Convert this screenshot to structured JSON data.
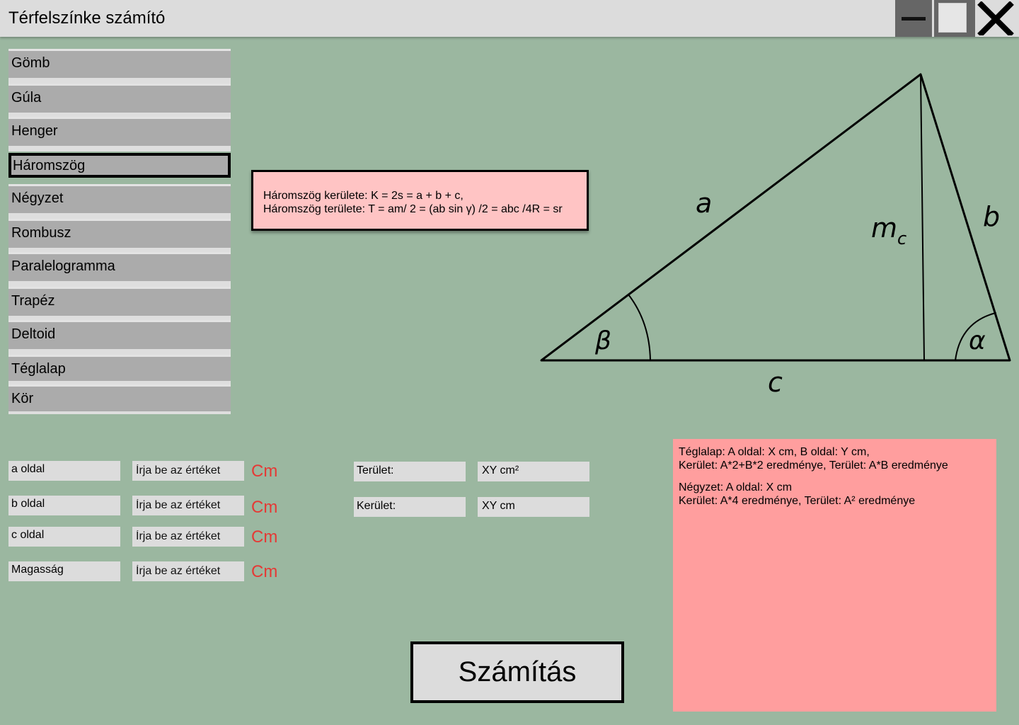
{
  "window": {
    "title": "Térfelszínke számító",
    "controls": {
      "minimize_icon": "minus-icon",
      "maximize_icon": "square-icon",
      "close_icon": "x-icon"
    }
  },
  "sidebar": {
    "items": [
      {
        "label": "Gömb",
        "selected": false
      },
      {
        "label": "Gúla",
        "selected": false
      },
      {
        "label": "Henger",
        "selected": false
      },
      {
        "label": "Háromszög",
        "selected": true
      },
      {
        "label": "Négyzet",
        "selected": false
      },
      {
        "label": "Rombusz",
        "selected": false
      },
      {
        "label": "Paralelogramma",
        "selected": false
      },
      {
        "label": "Trapéz",
        "selected": false
      },
      {
        "label": "Deltoid",
        "selected": false
      },
      {
        "label": "Téglalap",
        "selected": false
      },
      {
        "label": "Kör",
        "selected": false
      }
    ]
  },
  "formula": {
    "line1": "Háromszög kerülete: K = 2s = a + b + c,",
    "line2": "Háromszög területe: T = am/ 2 = (ab sin γ) /2 = abc /4R = sr"
  },
  "diagram": {
    "label_a": "a",
    "label_b": "b",
    "label_c": "c",
    "label_height": "m",
    "label_height_sub": "c",
    "label_alpha": "α",
    "label_beta": "β"
  },
  "inputs": [
    {
      "label": "a oldal",
      "placeholder": "Írja be az értéket",
      "unit": "Cm"
    },
    {
      "label": "b oldal",
      "placeholder": "Írja be az értéket",
      "unit": "Cm"
    },
    {
      "label": "c oldal",
      "placeholder": "Írja be az értéket",
      "unit": "Cm"
    },
    {
      "label": "Magasság",
      "placeholder": "Írja be az értéket",
      "unit": "Cm"
    }
  ],
  "outputs": [
    {
      "label": "Terület:",
      "value": "XY cm²"
    },
    {
      "label": "Kerület:",
      "value": "XY cm"
    }
  ],
  "calculate_button": "Számítás",
  "info": {
    "rect_line1": "Téglalap: A oldal: X cm, B oldal: Y cm,",
    "rect_line2": "Kerület: A*2+B*2 eredménye, Terület: A*B eredménye",
    "square_line1": "Négyzet: A oldal: X cm",
    "square_line2": "Kerület: A*4 eredménye, Terület: A² eredménye"
  },
  "colors": {
    "background": "#9bb7a0",
    "formula_box": "#ffc4c4",
    "info_panel": "#ff9e9e",
    "unit_text": "#e53935"
  }
}
